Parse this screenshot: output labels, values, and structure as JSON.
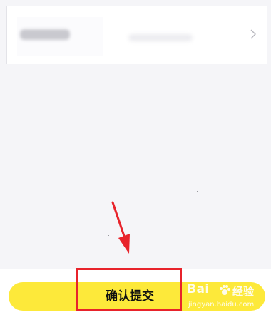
{
  "submit": {
    "label": "确认提交"
  },
  "watermark": {
    "logo": "Bai",
    "name": "经验",
    "url": "jingyan.baidu.com"
  },
  "colors": {
    "submit_bg": "#fde93a",
    "highlight": "#e8232b",
    "arrow": "#e8232b"
  },
  "icons": {
    "row_arrow": "chevron-right-icon",
    "annotation": "arrow-down-icon"
  }
}
